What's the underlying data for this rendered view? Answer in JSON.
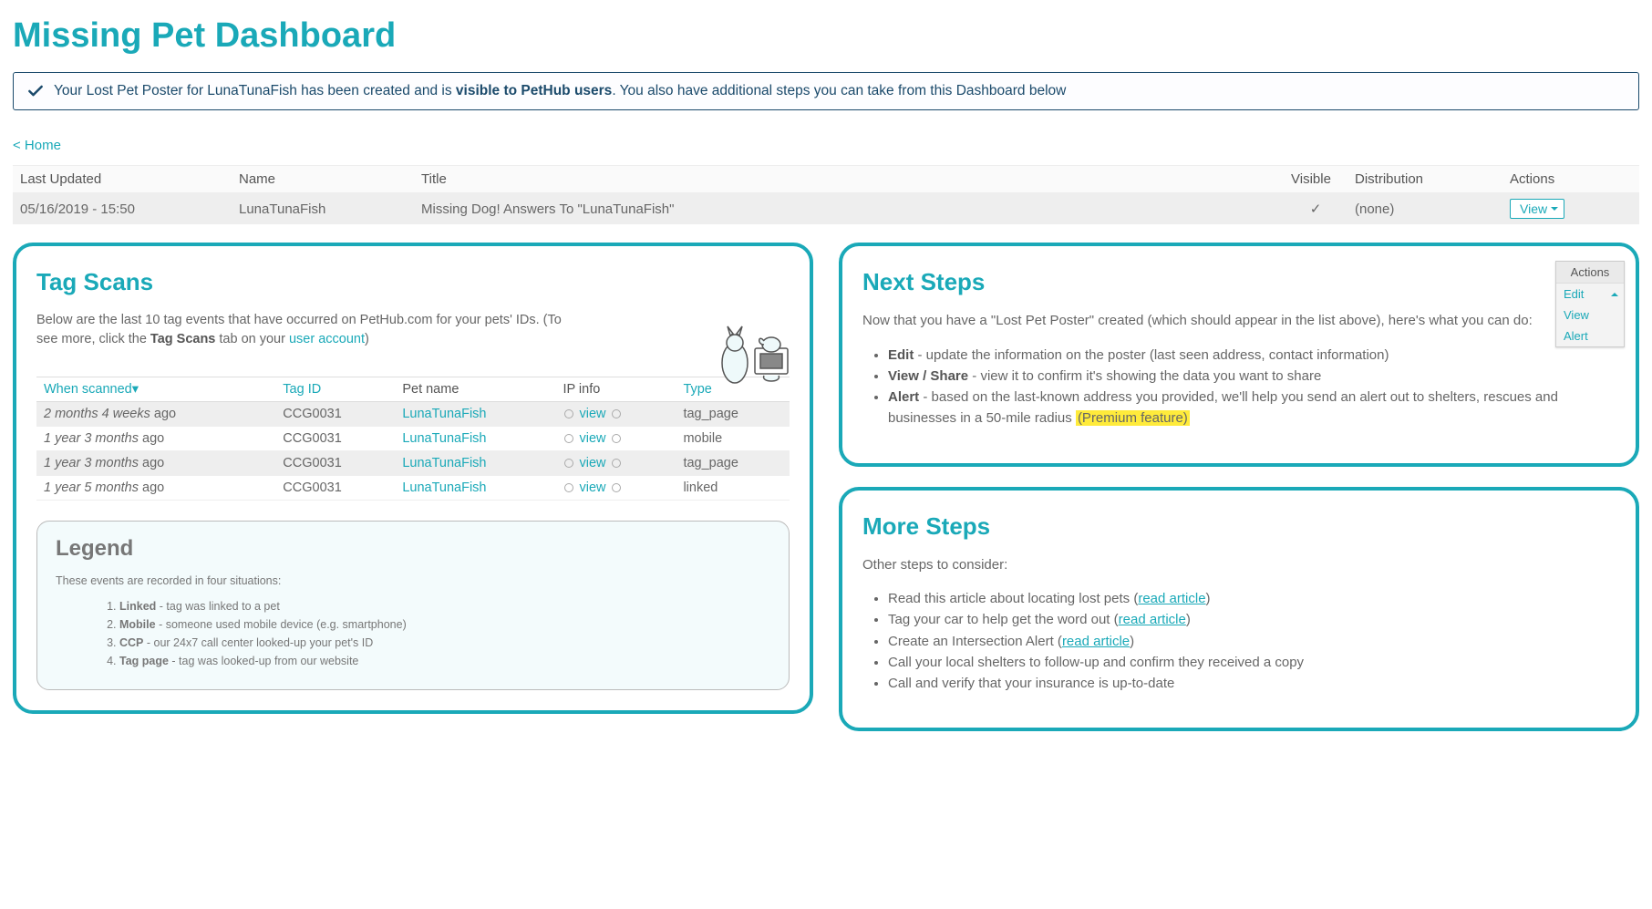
{
  "page": {
    "title": "Missing Pet Dashboard"
  },
  "alert": {
    "prefix": "Your Lost Pet Poster for LunaTunaFish has been created and is ",
    "bold": "visible to PetHub users",
    "suffix": ". You also have additional steps you can take from this Dashboard below"
  },
  "nav": {
    "home": "< Home"
  },
  "poster_table": {
    "headers": {
      "updated": "Last Updated",
      "name": "Name",
      "title": "Title",
      "visible": "Visible",
      "distribution": "Distribution",
      "actions": "Actions"
    },
    "row": {
      "updated": "05/16/2019 - 15:50",
      "name": "LunaTunaFish",
      "title": "Missing Dog! Answers To \"LunaTunaFish\"",
      "visible": "✓",
      "distribution": "(none)",
      "action_label": "View"
    }
  },
  "tagscans": {
    "heading": "Tag Scans",
    "blurb_a": "Below are the last 10 tag events that have occurred on PetHub.com for your pets' IDs. (To see more, click the ",
    "blurb_b": "Tag Scans",
    "blurb_c": " tab on your ",
    "blurb_link": "user account",
    "blurb_d": ")",
    "cols": {
      "when": "When scanned",
      "tag": "Tag ID",
      "pet": "Pet name",
      "ip": "IP info",
      "type": "Type"
    },
    "rows": [
      {
        "when_i": "2 months 4 weeks",
        "when_s": " ago",
        "tag": "CCG0031",
        "pet": "LunaTunaFish",
        "ip": "view",
        "type": "tag_page"
      },
      {
        "when_i": "1 year 3 months",
        "when_s": " ago",
        "tag": "CCG0031",
        "pet": "LunaTunaFish",
        "ip": "view",
        "type": "mobile"
      },
      {
        "when_i": "1 year 3 months",
        "when_s": " ago",
        "tag": "CCG0031",
        "pet": "LunaTunaFish",
        "ip": "view",
        "type": "tag_page"
      },
      {
        "when_i": "1 year 5 months",
        "when_s": " ago",
        "tag": "CCG0031",
        "pet": "LunaTunaFish",
        "ip": "view",
        "type": "linked"
      }
    ]
  },
  "legend": {
    "heading": "Legend",
    "intro": "These events are recorded in four situations:",
    "items": [
      {
        "b": "Linked",
        "t": " - tag was linked to a pet"
      },
      {
        "b": "Mobile",
        "t": " - someone used mobile device (e.g. smartphone)"
      },
      {
        "b": "CCP",
        "t": " - our 24x7 call center looked-up your pet's ID"
      },
      {
        "b": "Tag page",
        "t": " - tag was looked-up from our website"
      }
    ]
  },
  "nextsteps": {
    "heading": "Next Steps",
    "intro": "Now that you have a \"Lost Pet Poster\" created (which should appear in the list above), here's what you can do:",
    "menu_header": "Actions",
    "menu": {
      "edit": "Edit",
      "view": "View",
      "alert": "Alert"
    },
    "items": {
      "edit_b": "Edit",
      "edit_t": " - update the information on the poster (last seen address, contact information)",
      "view_b": "View / Share",
      "view_t": " - view it to confirm it's showing the data you want to share",
      "alert_b": "Alert",
      "alert_t": " - based on the last-known address you provided, we'll help you send an alert out to shelters, rescues and businesses in a 50-mile radius ",
      "alert_hl": "(Premium feature)"
    }
  },
  "moresteps": {
    "heading": "More Steps",
    "intro": "Other steps to consider:",
    "i1a": "Read this article about locating lost pets (",
    "i1l": "read article",
    "i1b": ")",
    "i2a": "Tag your car to help get the word out (",
    "i2l": "read article",
    "i2b": ")",
    "i3a": "Create an Intersection Alert (",
    "i3l": "read article",
    "i3b": ")",
    "i4": "Call your local shelters to follow-up and confirm they received a copy",
    "i5": "Call and verify that your insurance is up-to-date"
  }
}
